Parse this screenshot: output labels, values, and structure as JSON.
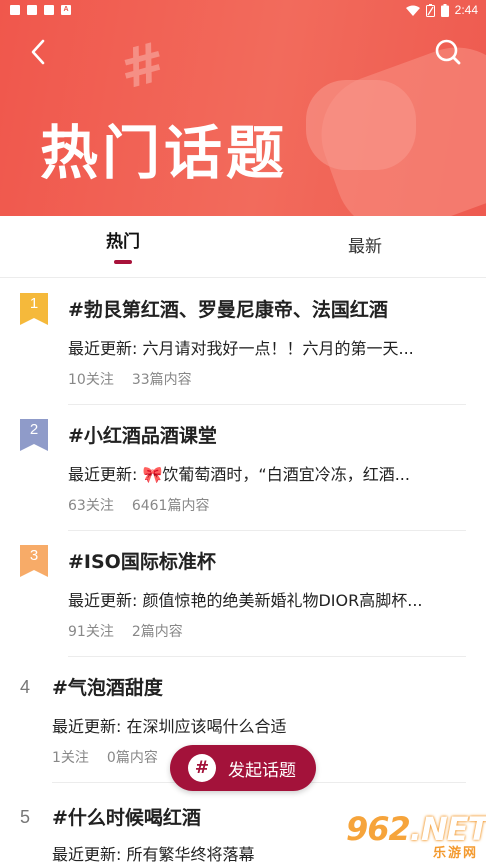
{
  "status_bar": {
    "time": "2:44",
    "left_icons": [
      "notification-square-icon",
      "notification-square-icon",
      "notification-square-icon",
      "a-badge-icon"
    ],
    "right_icons": [
      "wifi-icon",
      "battery-saver-icon",
      "battery-icon"
    ]
  },
  "header": {
    "title": "热门话题",
    "back_icon": "chevron-left-icon",
    "search_icon": "search-icon",
    "colors": {
      "banner": "#f0574c",
      "accent": "#a8123a"
    }
  },
  "tabs": [
    {
      "label": "热门",
      "active": true
    },
    {
      "label": "最新",
      "active": false
    }
  ],
  "topics": [
    {
      "rank": "1",
      "title": "#勃艮第红酒、罗曼尼康帝、法国红酒",
      "latest": "最近更新: 六月请对我好一点！！六月的第一天...",
      "follows": "10关注",
      "posts": "33篇内容",
      "badge_color": "#f5b93b"
    },
    {
      "rank": "2",
      "title": "#小红酒品酒课堂",
      "latest": "最近更新: 🎀饮葡萄酒时，“白酒宜冷冻，红酒...",
      "follows": "63关注",
      "posts": "6461篇内容",
      "badge_color": "#8f9bc9"
    },
    {
      "rank": "3",
      "title": "#ISO国际标准杯",
      "latest": "最近更新: 颜值惊艳的绝美新婚礼物DIOR高脚杯...",
      "follows": "91关注",
      "posts": "2篇内容",
      "badge_color": "#f7ab68"
    },
    {
      "rank": "4",
      "title": "#气泡酒甜度",
      "latest": "最近更新: 在深圳应该喝什么合适",
      "follows": "1关注",
      "posts": "0篇内容"
    },
    {
      "rank": "5",
      "title": "#什么时候喝红酒",
      "latest": "最近更新: 所有繁华终将落幕"
    }
  ],
  "fab": {
    "label": "发起话题",
    "icon": "hash-icon"
  },
  "watermark": {
    "number": "962",
    "suffix": ".NET",
    "text": "乐游网"
  }
}
